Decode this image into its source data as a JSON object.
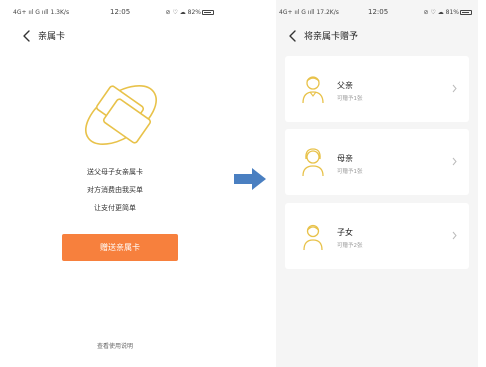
{
  "left_screen": {
    "statusbar": {
      "left": "4G+ ııl  G ııll  1.3K/s",
      "time": "12:05",
      "right": "⊘ ♡ ☁ 82%"
    },
    "title": "亲属卡",
    "promo_lines": [
      "送父母子女亲属卡",
      "对方消费由我买单",
      "让支付更简单"
    ],
    "gift_button": "赠送亲属卡",
    "usage_link": "查看使用说明"
  },
  "right_screen": {
    "statusbar": {
      "left": "4G+ ııl  G ııll  17.2K/s",
      "time": "12:05",
      "right": "⊘ ♡ ☁ 81%"
    },
    "title": "将亲属卡赠予",
    "recipients": [
      {
        "name": "父亲",
        "sub": "可赠予1张",
        "icon": "father-avatar-icon"
      },
      {
        "name": "母亲",
        "sub": "可赠予1张",
        "icon": "mother-avatar-icon"
      },
      {
        "name": "子女",
        "sub": "可赠予2张",
        "icon": "child-avatar-icon"
      }
    ]
  },
  "colors": {
    "accent": "#f7803d",
    "icon_gold": "#e8c24a",
    "arrow": "#4a7fc1",
    "panel_bg": "#f5f5f5"
  }
}
